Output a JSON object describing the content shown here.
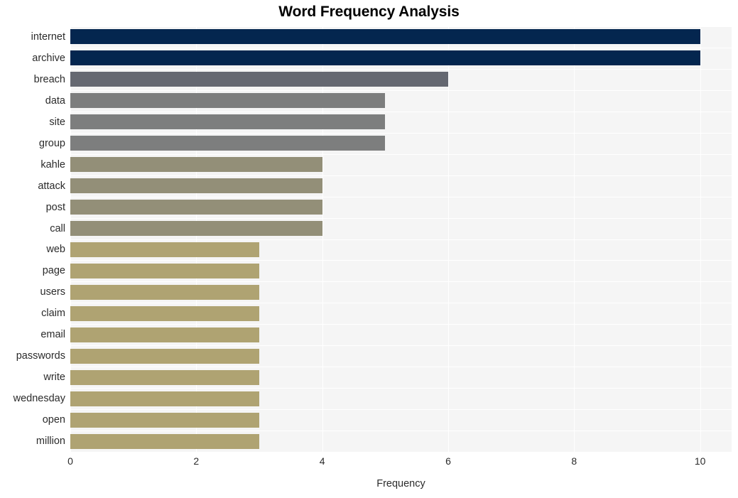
{
  "chart_data": {
    "type": "bar",
    "orientation": "horizontal",
    "title": "Word Frequency Analysis",
    "xlabel": "Frequency",
    "ylabel": "",
    "xlim": [
      0,
      10.5
    ],
    "xticks": [
      0,
      2,
      4,
      6,
      8,
      10
    ],
    "xtick_labels": [
      "0",
      "2",
      "4",
      "6",
      "8",
      "10"
    ],
    "grid": true,
    "legend": null,
    "categories": [
      "internet",
      "archive",
      "breach",
      "data",
      "site",
      "group",
      "kahle",
      "attack",
      "post",
      "call",
      "web",
      "page",
      "users",
      "claim",
      "email",
      "passwords",
      "write",
      "wednesday",
      "open",
      "million"
    ],
    "values": [
      10,
      10,
      6,
      5,
      5,
      5,
      4,
      4,
      4,
      4,
      3,
      3,
      3,
      3,
      3,
      3,
      3,
      3,
      3,
      3
    ],
    "bar_colors": [
      "#04264f",
      "#04264f",
      "#656871",
      "#7d7e7e",
      "#7d7e7e",
      "#7d7e7e",
      "#938f78",
      "#938f78",
      "#938f78",
      "#938f78",
      "#afa372",
      "#afa372",
      "#afa372",
      "#afa372",
      "#afa372",
      "#afa372",
      "#afa372",
      "#afa372",
      "#afa372",
      "#afa372"
    ],
    "style": {
      "plot_background": "#f5f5f5",
      "figure_background": "#ffffff",
      "gridline_color": "#ffffff",
      "text_color": "#2b2b2b",
      "title_color": "#000000"
    }
  }
}
